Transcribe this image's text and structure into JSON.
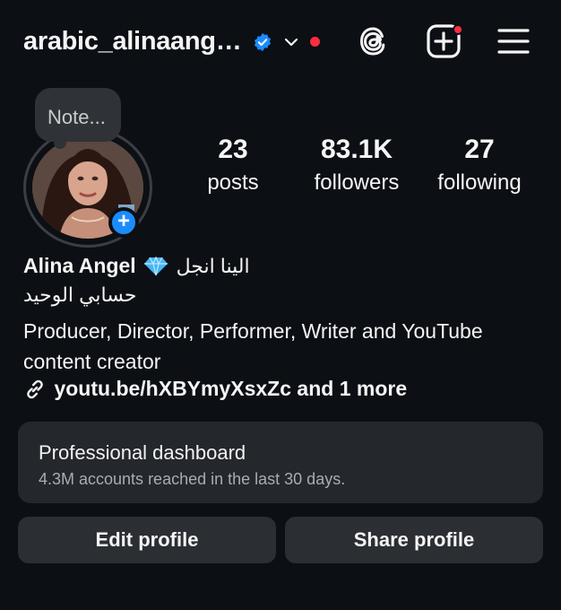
{
  "header": {
    "username": "arabic_alinaang…",
    "icons": [
      "verified-badge-icon",
      "chevron-down-icon",
      "notification-dot",
      "threads-icon",
      "create-post-icon",
      "hamburger-menu-icon"
    ],
    "accent_colors": {
      "verified": "#1a8cff",
      "notification": "#ff2d3f"
    }
  },
  "note": {
    "placeholder": "Note..."
  },
  "stats": [
    {
      "value": "23",
      "label": "posts"
    },
    {
      "value": "83.1K",
      "label": "followers"
    },
    {
      "value": "27",
      "label": "following"
    }
  ],
  "profile": {
    "name": "Alina Angel",
    "name_arabic": "الينا انجل",
    "subtitle_arabic": "حسابي الوحيد",
    "bio": "Producer, Director, Performer, Writer and YouTube content creator",
    "link": "youtu.be/hXBYmyXsxZc and 1 more"
  },
  "dashboard": {
    "title": "Professional dashboard",
    "subtitle": "4.3M accounts reached in the last 30 days."
  },
  "actions": {
    "edit_label": "Edit profile",
    "share_label": "Share profile"
  }
}
